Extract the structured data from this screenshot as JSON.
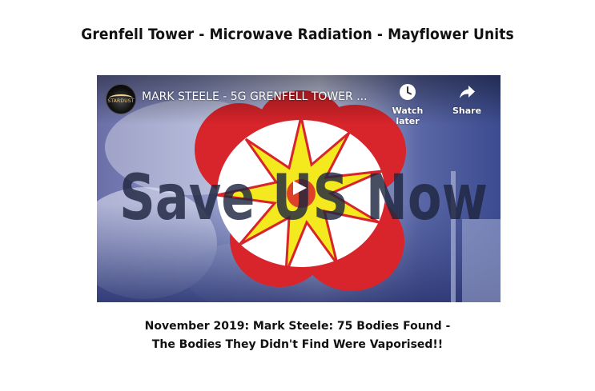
{
  "page": {
    "title": "Grenfell Tower - Microwave Radiation - Mayflower Units"
  },
  "video": {
    "title": "MARK STEELE - 5G GRENFELL TOWER ...",
    "channel_avatar_text": "STARDUST",
    "thumbnail_text": "Save US Now",
    "watch_later_label": "Watch later",
    "share_label": "Share",
    "icons": {
      "watch_later": "clock-icon",
      "share": "share-arrow-icon",
      "play": "play-icon"
    },
    "colors": {
      "flag_red": "#d8242b",
      "flag_yellow": "#f3e91e",
      "sky_blue": "#4f63a8"
    }
  },
  "caption": {
    "line1": "November 2019: Mark Steele: 75 Bodies Found -",
    "line2": "The Bodies They Didn't Find Were Vaporised!!"
  }
}
